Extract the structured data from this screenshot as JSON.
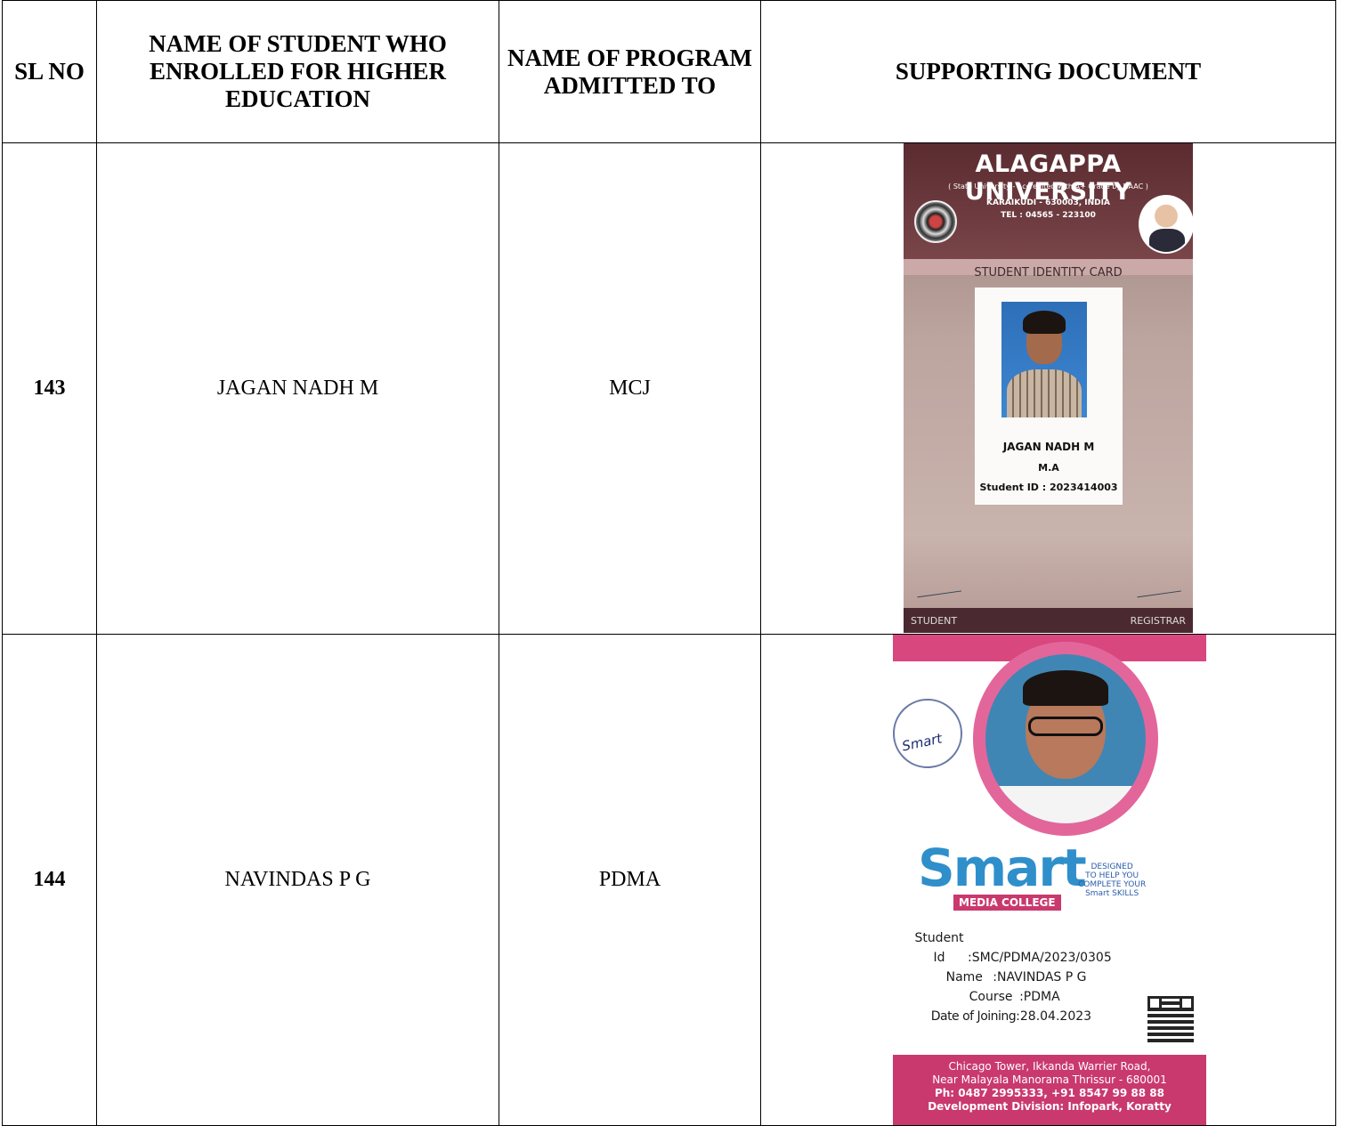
{
  "headers": {
    "sl": "SL NO",
    "student": "NAME OF STUDENT WHO ENROLLED FOR HIGHER EDUCATION",
    "program": "NAME OF PROGRAM ADMITTED TO",
    "doc": "SUPPORTING DOCUMENT"
  },
  "rows": [
    {
      "sl": "143",
      "name": "JAGAN NADH M",
      "program": "MCJ",
      "card": {
        "university": "ALAGAPPA UNIVERSITY",
        "accreditation": "( State University - Accredited with A+ Grade by NAAC )",
        "address": "KARAIKUDI - 630003, INDIA",
        "tel": "TEL : 04565 - 223100",
        "card_title": "STUDENT IDENTITY CARD",
        "student_name": "JAGAN NADH M",
        "degree": "M.A",
        "student_id": "Student ID : 2023414003",
        "footer_left": "STUDENT",
        "footer_right": "REGISTRAR"
      }
    },
    {
      "sl": "144",
      "name": "NAVINDAS P G",
      "program": "PDMA",
      "card": {
        "stamp_text": "Smart",
        "logo_pre": "S",
        "logo_mid": "ma",
        "logo_post": "rt",
        "college": "MEDIA COLLEGE",
        "tagline_1": "DESIGNED",
        "tagline_2": "TO HELP YOU",
        "tagline_3": "COMPLETE YOUR",
        "tagline_4": "Smart SKILLS",
        "id_label": "Student Id",
        "id_value": ":SMC/PDMA/2023/0305",
        "name_label": "Name",
        "name_value": ":NAVINDAS P G",
        "course_label": "Course",
        "course_value": ":PDMA",
        "doj_label": "Date of Joining",
        "doj_value": ":28.04.2023",
        "footer_1": "Chicago Tower, Ikkanda Warrier Road,",
        "footer_2": "Near Malayala Manorama Thrissur - 680001",
        "footer_3": "Ph: 0487 2995333, +91 8547 99 88 88",
        "footer_4": "Development Division: Infopark, Koratty"
      }
    }
  ]
}
